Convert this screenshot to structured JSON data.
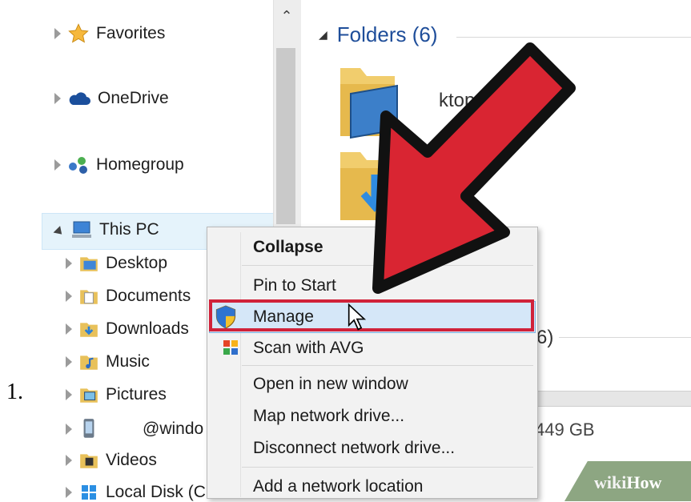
{
  "step_number": "1.",
  "nav": {
    "favorites": "Favorites",
    "onedrive": "OneDrive",
    "homegroup": "Homegroup",
    "this_pc": "This PC",
    "children": [
      "Desktop",
      "Documents",
      "Downloads",
      "Music",
      "Pictures",
      "@windo",
      "Videos",
      "Local Disk (C"
    ]
  },
  "folders": {
    "heading": "Folders (6)",
    "partial_label": "ktop"
  },
  "devices": {
    "partial_heading": "6)",
    "drive_free": "449 GB"
  },
  "context_menu": {
    "items": [
      "Collapse",
      "Pin to Start",
      "Manage",
      "Scan with AVG",
      "Open in new window",
      "Map network drive...",
      "Disconnect network drive...",
      "Add a network location"
    ]
  },
  "watermark": {
    "part1": "wiki",
    "part2": "How"
  },
  "colors": {
    "arrow_red": "#d92532",
    "highlight_red": "#d0223a",
    "heading_blue": "#1f4e9a",
    "selection": "#e5f3fb"
  }
}
